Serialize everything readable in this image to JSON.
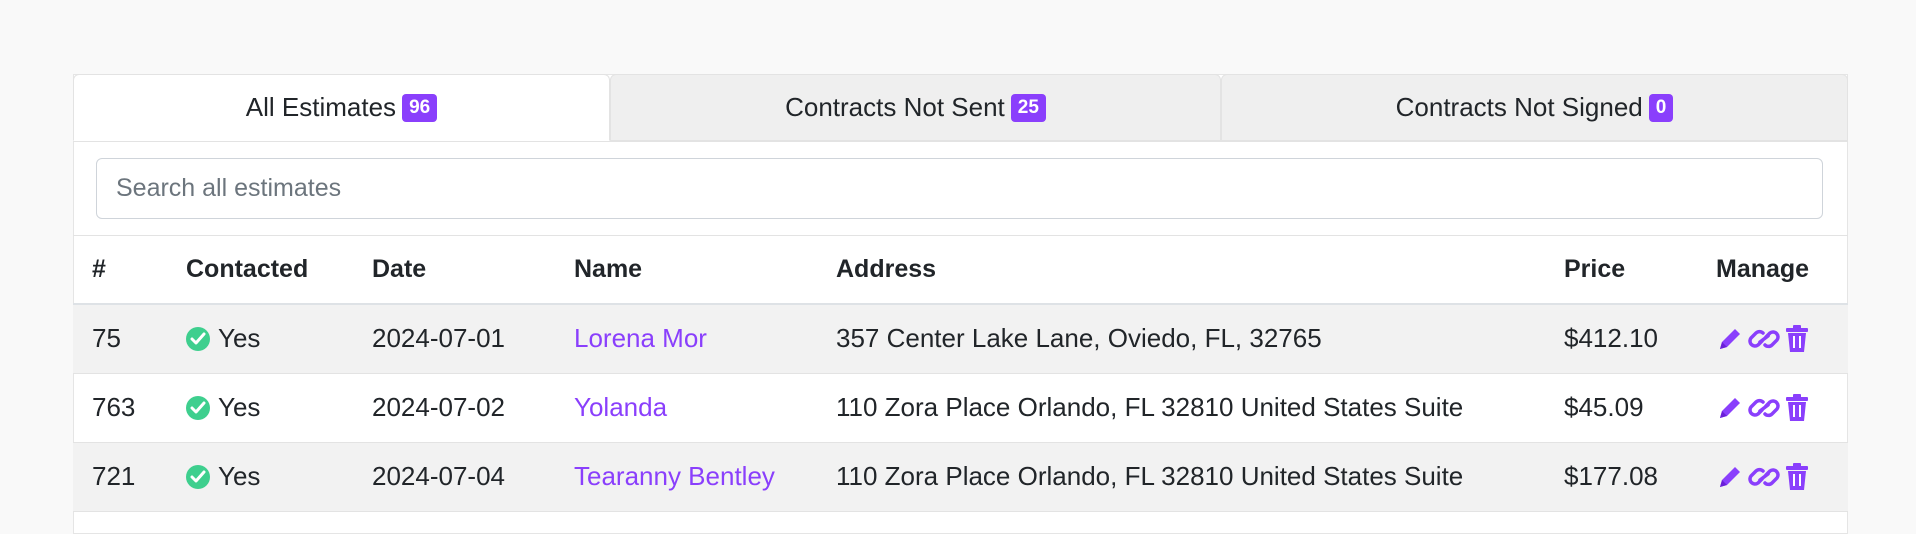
{
  "tabs": [
    {
      "label": "All Estimates",
      "count": "96",
      "active": true
    },
    {
      "label": "Contracts Not Sent",
      "count": "25",
      "active": false
    },
    {
      "label": "Contracts Not Signed",
      "count": "0",
      "active": false
    }
  ],
  "search": {
    "placeholder": "Search all estimates",
    "value": ""
  },
  "table": {
    "columns": [
      "#",
      "Contacted",
      "Date",
      "Name",
      "Address",
      "Price",
      "Manage"
    ],
    "rows": [
      {
        "id": "75",
        "contacted": "Yes",
        "date": "2024-07-01",
        "name": "Lorena Mor",
        "address": "357 Center Lake Lane, Oviedo, FL, 32765",
        "price": "$412.10"
      },
      {
        "id": "763",
        "contacted": "Yes",
        "date": "2024-07-02",
        "name": "Yolanda",
        "address": "110 Zora Place Orlando, FL 32810 United States Suite",
        "price": "$45.09"
      },
      {
        "id": "721",
        "contacted": "Yes",
        "date": "2024-07-04",
        "name": "Tearanny Bentley",
        "address": "110 Zora Place Orlando, FL 32810 United States Suite",
        "price": "$177.08"
      }
    ]
  },
  "icons": {
    "contacted": "check-circle-icon",
    "edit": "pencil-icon",
    "link": "link-icon",
    "delete": "trash-icon"
  },
  "colors": {
    "accent": "#8a3ffc",
    "success": "#3ecf8e"
  }
}
